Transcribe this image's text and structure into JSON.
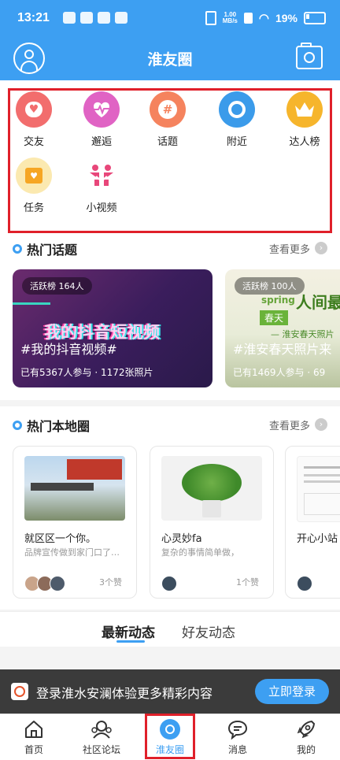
{
  "status_bar": {
    "time": "13:21",
    "net_speed": "1.00\nMB/s",
    "battery": "19%"
  },
  "header": {
    "title": "淮友圈"
  },
  "categories": [
    {
      "label": "交友",
      "icon": "heart-chat-icon",
      "color": "#f26d6d"
    },
    {
      "label": "邂逅",
      "icon": "heartbeat-icon",
      "color": "#e063c4"
    },
    {
      "label": "话题",
      "icon": "hashtag-icon",
      "color": "#f5835e"
    },
    {
      "label": "附近",
      "icon": "location-pin-icon",
      "color": "#3b9bea"
    },
    {
      "label": "达人榜",
      "icon": "crown-icon",
      "color": "#f6b52c"
    },
    {
      "label": "任务",
      "icon": "task-calendar-icon",
      "color": "#f6b52c"
    },
    {
      "label": "小视频",
      "icon": "two-people-icon",
      "color": "#e8477a"
    }
  ],
  "hot_topics": {
    "title": "热门话题",
    "more": "查看更多",
    "cards": [
      {
        "badge": "活跃榜 164人",
        "name": "#我的抖音视频#",
        "stats": "已有5367人参与 · 1172张照片",
        "banner": "我的抖音短视频"
      },
      {
        "badge": "活跃榜 100人",
        "name": "#淮安春天照片来",
        "stats": "已有1469人参与 · 69",
        "banner_spring": "spring",
        "banner_title": "人间最",
        "banner_sub": "春天",
        "banner_sub2": "— 淮安春天照片"
      }
    ]
  },
  "local_circles": {
    "title": "热门本地圈",
    "more": "查看更多",
    "cards": [
      {
        "title": "就区区一个你。",
        "desc": "品牌宣传做到家门口了…",
        "likes": "3个赞"
      },
      {
        "title": "心灵妙fa",
        "desc": "复杂的事情简单做，",
        "likes": "1个赞"
      },
      {
        "title": "开心小站",
        "desc": "",
        "likes": ""
      }
    ]
  },
  "feed_tabs": {
    "latest": "最新动态",
    "friends": "好友动态"
  },
  "login_bar": {
    "text": "登录淮水安澜体验更多精彩内容",
    "button": "立即登录"
  },
  "tab_bar": [
    {
      "label": "首页",
      "icon": "home-icon"
    },
    {
      "label": "社区论坛",
      "icon": "community-icon"
    },
    {
      "label": "淮友圈",
      "icon": "circle-camera-icon"
    },
    {
      "label": "消息",
      "icon": "message-icon"
    },
    {
      "label": "我的",
      "icon": "rocket-icon"
    }
  ]
}
